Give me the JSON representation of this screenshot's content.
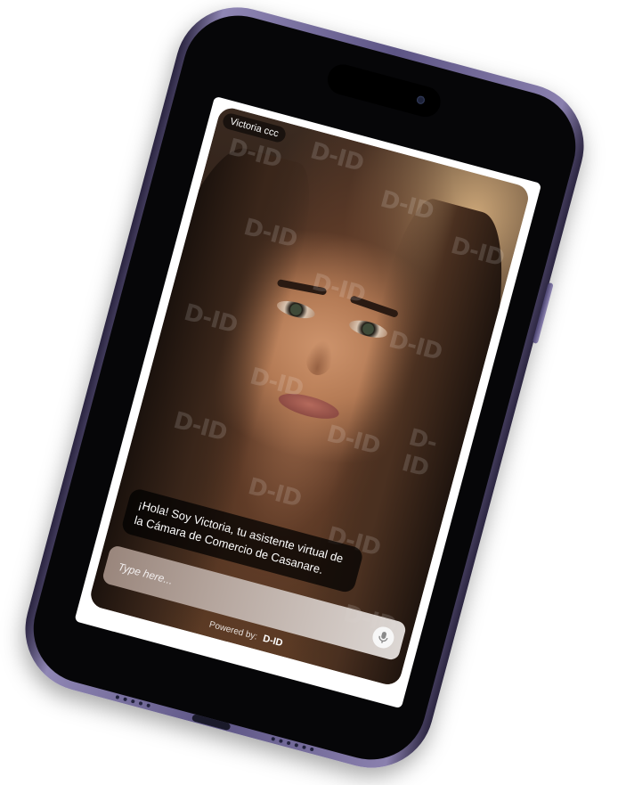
{
  "agent": {
    "name": "Victoria ccc"
  },
  "chat": {
    "greeting": "¡Hola! Soy Victoria, tu asistente virtual de la Cámara de Comercio de Casanare.",
    "input_placeholder": "Type here..."
  },
  "footer": {
    "powered_label": "Powered by:",
    "brand_logo": "D-ID"
  },
  "watermark": "D-ID",
  "icons": {
    "microphone": "microphone-icon"
  },
  "colors": {
    "phone_frame": "#6b6394",
    "screen_bg": "#ffffff",
    "bubble_bg": "#000000"
  }
}
